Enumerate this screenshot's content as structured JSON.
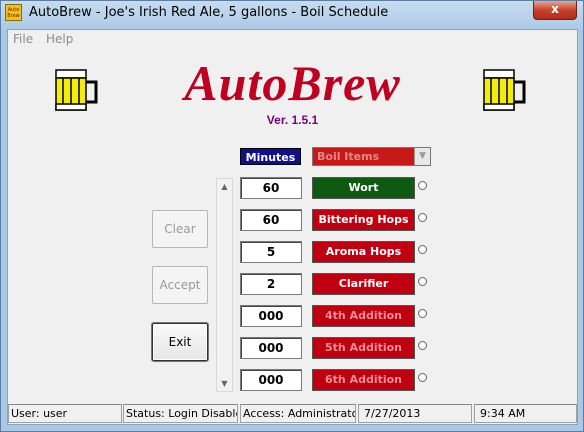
{
  "window": {
    "title": "AutoBrew - Joe's Irish Red Ale, 5 gallons - Boil Schedule",
    "icon_text": "Auto Brew",
    "close_label": "x"
  },
  "menu": {
    "items": [
      "File",
      "Help"
    ]
  },
  "header": {
    "logo": "AutoBrew",
    "version": "Ver. 1.5.1"
  },
  "columns": {
    "minutes_label": "Minutes",
    "items_placeholder": "Boil Items"
  },
  "buttons": {
    "clear": "Clear",
    "accept": "Accept",
    "exit": "Exit"
  },
  "boil_items": [
    {
      "minutes": "60",
      "label": "Wort",
      "bg": "#0d5a10",
      "fg": "#ffffff"
    },
    {
      "minutes": "60",
      "label": "Bittering Hops",
      "bg": "#c00010",
      "fg": "#ffffff"
    },
    {
      "minutes": "5",
      "label": "Aroma Hops",
      "bg": "#c00010",
      "fg": "#ffffff"
    },
    {
      "minutes": "2",
      "label": "Clarifier",
      "bg": "#c00010",
      "fg": "#ffffff"
    },
    {
      "minutes": "000",
      "label": "4th Addition",
      "bg": "#c00010",
      "fg": "#e89090"
    },
    {
      "minutes": "000",
      "label": "5th Addition",
      "bg": "#c00010",
      "fg": "#e89090"
    },
    {
      "minutes": "000",
      "label": "6th Addition",
      "bg": "#c00010",
      "fg": "#e89090"
    }
  ],
  "status": {
    "user": "User: user",
    "login": "Status: Login Disabled",
    "access": "Access: Administrator",
    "date": "7/27/2013",
    "time": "9:34 AM"
  },
  "icons": {
    "beer": "beer-mug-icon",
    "scroll_up": "scroll-up-arrow-icon",
    "scroll_down": "scroll-down-arrow-icon",
    "dropdown": "chevron-down-icon"
  },
  "colors": {
    "logo": "#c00020",
    "version": "#7a007a",
    "minutes_label_bg": "#10108a"
  }
}
